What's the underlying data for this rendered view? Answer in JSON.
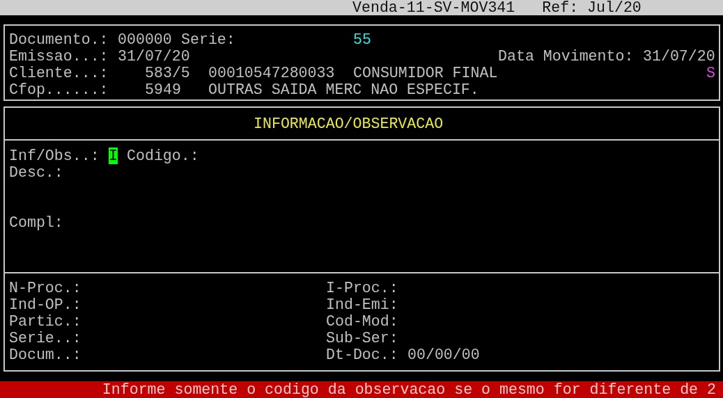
{
  "title_bar": {
    "title": "Venda-11-SV-MOV341",
    "ref": "Ref: Jul/20"
  },
  "document": {
    "documento_label": "Documento.:",
    "documento": "000000",
    "serie_label": "Serie:",
    "serie": "55",
    "emissao_label": "Emissao...:",
    "emissao": "31/07/20",
    "data_movimento_label": "Data Movimento:",
    "data_movimento": "31/07/20",
    "cliente_label": "Cliente...:",
    "cliente_code": "583/5",
    "cliente_cnpj": "00010547280033",
    "cliente_name": "CONSUMIDOR FINAL",
    "cliente_flag": "S",
    "cfop_label": "Cfop......:",
    "cfop": "5949",
    "cfop_desc": "OUTRAS SAIDA MERC NAO ESPECIF."
  },
  "panel": {
    "title": "INFORMACAO/OBSERVACAO",
    "inf_obs_label": "Inf/Obs..:",
    "inf_obs": {
      "value": "I",
      "focused": true
    },
    "codigo_label": "Codigo.:",
    "desc_label": "Desc.:",
    "compl_label": "Compl:"
  },
  "details": {
    "left": [
      {
        "label": "N-Proc.:"
      },
      {
        "label": "Ind-OP.:"
      },
      {
        "label": "Partic.:"
      },
      {
        "label": "Serie..:"
      },
      {
        "label": "Docum..:"
      }
    ],
    "right": [
      {
        "label": "I-Proc.:"
      },
      {
        "label": "Ind-Emi:"
      },
      {
        "label": "Cod-Mod:"
      },
      {
        "label": "Sub-Ser:"
      },
      {
        "label": "Dt-Doc.:",
        "value": "00/00/00"
      }
    ]
  },
  "status_message": "Informe somente o codigo da observacao se o mesmo for diferente de 2"
}
